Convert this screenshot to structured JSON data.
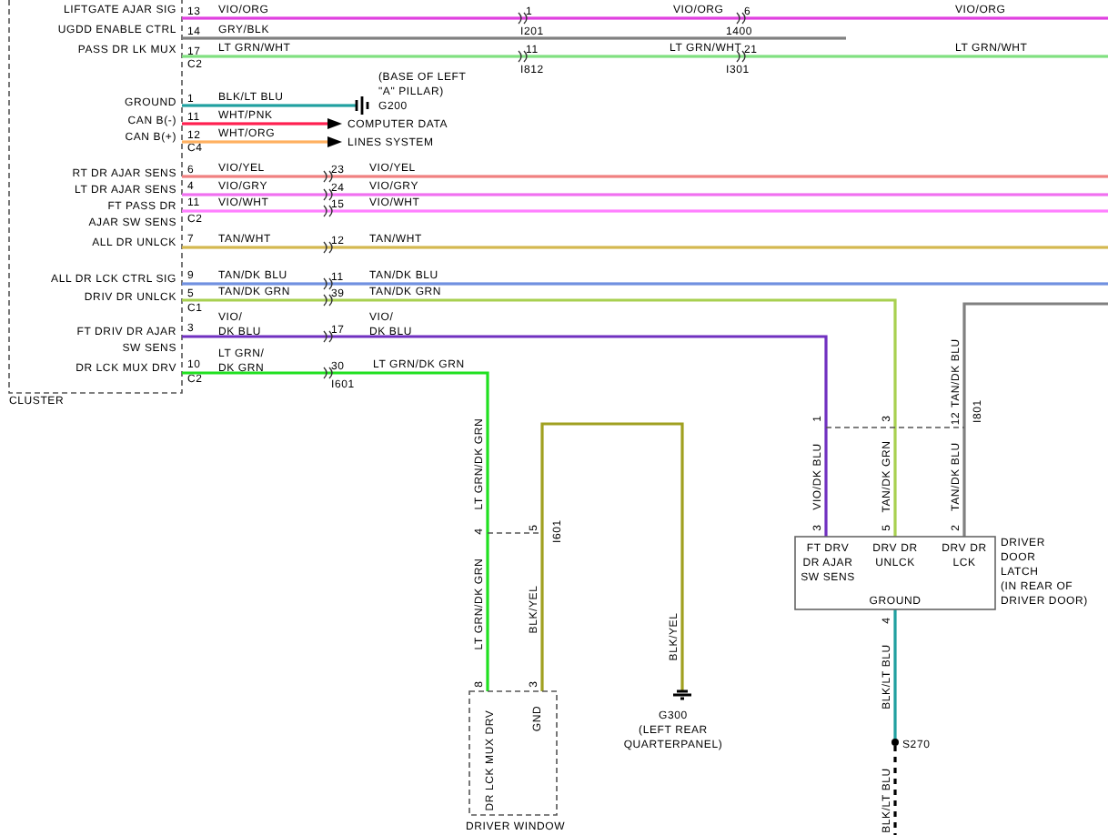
{
  "cluster": {
    "name": "CLUSTER",
    "pins": [
      {
        "label": "LIFTGATE AJAR SIG",
        "pin": "13"
      },
      {
        "label": "UGDD ENABLE CTRL",
        "pin": "14"
      },
      {
        "label": "PASS DR LK MUX",
        "pin": "17"
      },
      {
        "label": "GROUND",
        "pin": "1"
      },
      {
        "label": "CAN B(-)",
        "pin": "11"
      },
      {
        "label": "CAN B(+)",
        "pin": "12"
      },
      {
        "label": "RT DR AJAR SENS",
        "pin": "6"
      },
      {
        "label": "LT DR AJAR SENS",
        "pin": "4"
      },
      {
        "label": "FT PASS DR\nAJAR SW SENS",
        "pin": "11"
      },
      {
        "label": "ALL DR UNLCK",
        "pin": "7"
      },
      {
        "label": "ALL DR LCK CTRL SIG",
        "pin": "9"
      },
      {
        "label": "DRIV DR UNLCK",
        "pin": "5"
      },
      {
        "label": "FT DRIV DR AJAR\nSW SENS",
        "pin": "3"
      },
      {
        "label": "DR LCK MUX DRV",
        "pin": "10"
      }
    ],
    "connectors": [
      "C2",
      "C4",
      "C2",
      "C1",
      "C2"
    ]
  },
  "wires": [
    {
      "color": "#e040e0",
      "codes": [
        "VIO/ORG",
        "VIO/ORG",
        "VIO/ORG"
      ],
      "pins": [
        "1",
        "6",
        "I201",
        "1400"
      ]
    },
    {
      "color": "#808080",
      "codes": [
        "GRY/BLK"
      ]
    },
    {
      "color": "#80e080",
      "codes": [
        "LT GRN/WHT",
        "LT GRN/WHT",
        "LT GRN/WHT"
      ],
      "pins": [
        "11",
        "21",
        "I812",
        "I301"
      ]
    },
    {
      "color": "#20a0a0",
      "codes": [
        "BLK/LT BLU"
      ]
    },
    {
      "color": "#ff2050",
      "codes": [
        "WHT/PNK"
      ]
    },
    {
      "color": "#ffb060",
      "codes": [
        "WHT/ORG"
      ]
    },
    {
      "color": "#f08080",
      "codes": [
        "VIO/YEL",
        "VIO/YEL"
      ],
      "pins": [
        "23"
      ]
    },
    {
      "color": "#f070f0",
      "codes": [
        "VIO/GRY",
        "VIO/GRY"
      ],
      "pins": [
        "24"
      ]
    },
    {
      "color": "#ff80ff",
      "codes": [
        "VIO/WHT",
        "VIO/WHT"
      ],
      "pins": [
        "15"
      ]
    },
    {
      "color": "#d4b850",
      "codes": [
        "TAN/WHT",
        "TAN/WHT"
      ],
      "pins": [
        "12"
      ]
    },
    {
      "color": "#7090e0",
      "codes": [
        "TAN/DK BLU",
        "TAN/DK BLU"
      ],
      "pins": [
        "11"
      ]
    },
    {
      "color": "#a8d050",
      "codes": [
        "TAN/DK GRN",
        "TAN/DK GRN",
        "TAN/DK GRN"
      ],
      "pins": [
        "39",
        "3",
        "5"
      ]
    },
    {
      "color": "#7030c0",
      "codes": [
        "VIO/\nDK BLU",
        "VIO/\nDK BLU",
        "VIO/DK BLU"
      ],
      "pins": [
        "17",
        "1",
        "3"
      ]
    },
    {
      "color": "#20e020",
      "codes": [
        "LT GRN/\nDK GRN",
        "LT GRN/DK GRN",
        "LT GRN/DK GRN",
        "LT GRN/DK GRN"
      ],
      "pins": [
        "30",
        "I601",
        "4",
        "8"
      ]
    },
    {
      "color": "#a0a020",
      "codes": [
        "BLK/YEL",
        "BLK/YEL"
      ],
      "pins": [
        "3",
        "5",
        "I601"
      ]
    },
    {
      "color": "#808080",
      "codes": [
        "TAN/DK BLU",
        "TAN/DK BLU"
      ],
      "pins": [
        "12",
        "I801",
        "2"
      ]
    },
    {
      "color": "#20a0a0",
      "codes": [
        "BLK/LT BLU"
      ],
      "pins": [
        "4"
      ]
    },
    {
      "color": "#000000",
      "codes": [
        "BLK/LT BLU"
      ]
    }
  ],
  "grounds": [
    {
      "label": "(BASE OF LEFT\n\"A\" PILLAR)\nG200"
    },
    {
      "label": "G300\n(LEFT REAR\nQUARTERPANEL)"
    }
  ],
  "can_note": "COMPUTER DATA\nLINES SYSTEM",
  "latch": {
    "name": "DRIVER\nDOOR\nLATCH\n(IN REAR OF\nDRIVER DOOR)",
    "terminals": [
      "FT DRV\nDR AJAR\nSW SENS",
      "DRV DR\nUNLCK",
      "DRV DR\nLCK"
    ],
    "ground": "GROUND"
  },
  "window": {
    "name": "DRIVER WINDOW",
    "terminals": [
      "DR LCK MUX DRV",
      "GND"
    ]
  },
  "splice": "S270"
}
